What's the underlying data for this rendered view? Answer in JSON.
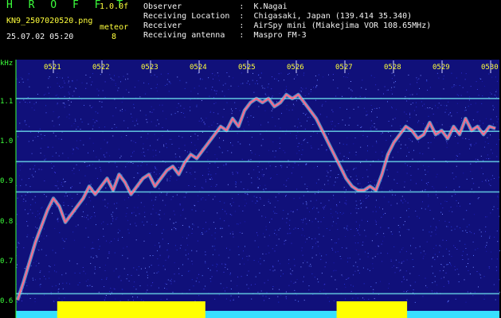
{
  "header": {
    "title": "H R O F F T",
    "version": "1.0.0f",
    "filename": "KN9_2507020520.png",
    "datetime": "25.07.02 05:20",
    "meteor_label": "meteor",
    "meteor_count": "8"
  },
  "info": {
    "observer": "Observer            :  K.Nagai",
    "location": "Receiving Location  :  Chigasaki, Japan (139.414 35.340)",
    "receiver": "Receiver            :  AirSpy mini (Miakejima VOR 108.65MHz)",
    "antenna": "Receiving antenna   :  Maspro FM-3"
  },
  "axis": {
    "y_unit": "kHz",
    "y_ticks": [
      "1.1",
      "1.0",
      "0.9",
      "0.8",
      "0.7",
      "0.6"
    ],
    "x_ticks": [
      "0521",
      "0522",
      "0523",
      "0524",
      "0525",
      "0526",
      "0527",
      "0528",
      "0529",
      "0530"
    ]
  },
  "colors": {
    "background": "#10107a",
    "trace": "#ff6a8c",
    "trace_edge": "#8ef5ff",
    "reference_lines": "#6ad8e8",
    "header_green": "#3cff3c",
    "header_yellow": "#ffff3c",
    "bottom_yellow": "#ffff00",
    "bottom_cyan": "#35e0ff"
  },
  "trace_khz": [
    0.605,
    0.65,
    0.7,
    0.75,
    0.79,
    0.83,
    0.86,
    0.84,
    0.8,
    0.82,
    0.84,
    0.86,
    0.89,
    0.87,
    0.89,
    0.91,
    0.88,
    0.92,
    0.9,
    0.87,
    0.89,
    0.91,
    0.92,
    0.89,
    0.91,
    0.93,
    0.94,
    0.92,
    0.95,
    0.97,
    0.96,
    0.98,
    1.0,
    1.02,
    1.04,
    1.03,
    1.06,
    1.04,
    1.08,
    1.1,
    1.11,
    1.1,
    1.11,
    1.09,
    1.1,
    1.12,
    1.11,
    1.12,
    1.1,
    1.08,
    1.06,
    1.03,
    1.0,
    0.97,
    0.94,
    0.91,
    0.89,
    0.88,
    0.88,
    0.89,
    0.88,
    0.92,
    0.97,
    1.0,
    1.02,
    1.04,
    1.03,
    1.01,
    1.02,
    1.05,
    1.02,
    1.03,
    1.01,
    1.04,
    1.02,
    1.06,
    1.03,
    1.04,
    1.02,
    1.04,
    1.035
  ],
  "reference_lines_khz": [
    1.11,
    1.028,
    0.952,
    0.876,
    0.621
  ],
  "bottom_segments": [
    {
      "start_min": 0.85,
      "end_min": 3.9,
      "active": true
    },
    {
      "start_min": 6.6,
      "end_min": 8.05,
      "active": true
    }
  ]
}
